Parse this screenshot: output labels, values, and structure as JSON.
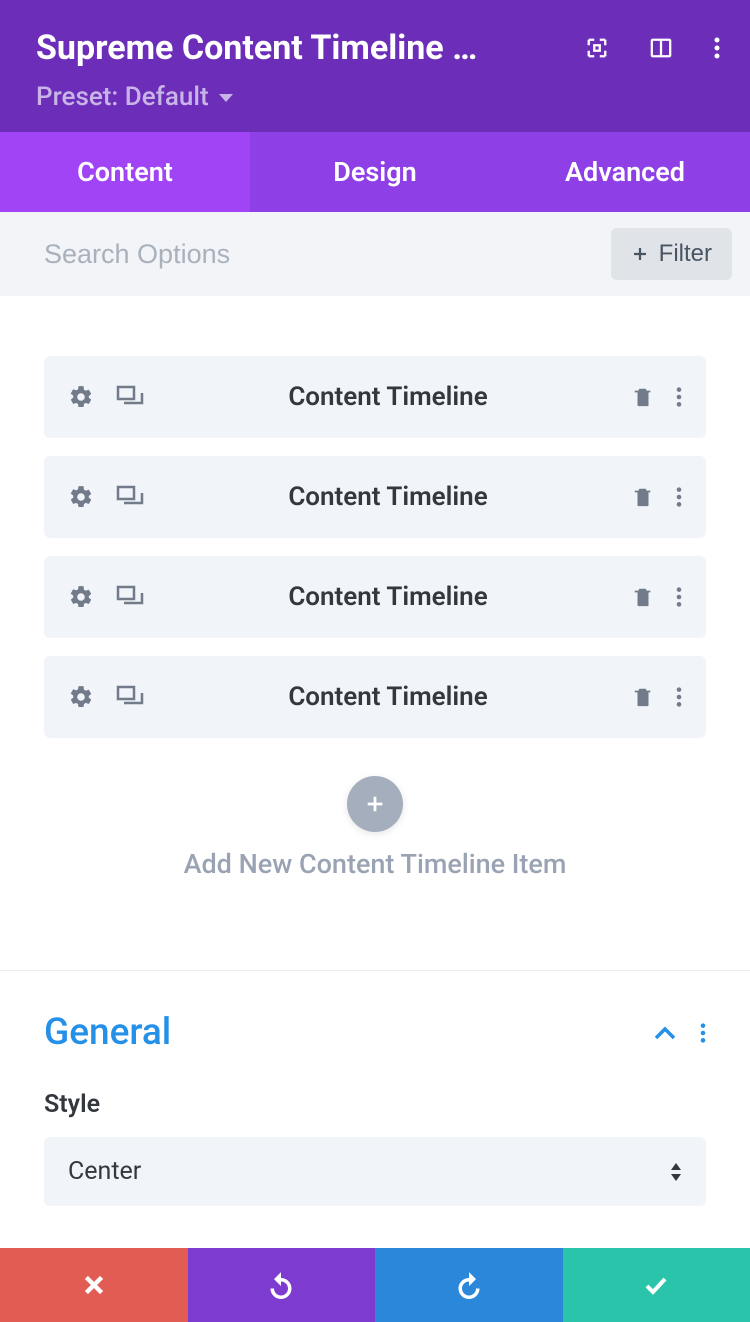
{
  "header": {
    "title": "Supreme Content Timeline …",
    "preset_prefix": "Preset:",
    "preset_name": "Default"
  },
  "tabs": {
    "content": "Content",
    "design": "Design",
    "advanced": "Advanced"
  },
  "search": {
    "placeholder": "Search Options"
  },
  "filter": {
    "label": "Filter"
  },
  "timeline_items": [
    {
      "label": "Content Timeline"
    },
    {
      "label": "Content Timeline"
    },
    {
      "label": "Content Timeline"
    },
    {
      "label": "Content Timeline"
    }
  ],
  "add_new": {
    "label": "Add New Content Timeline Item"
  },
  "general": {
    "title": "General",
    "style_label": "Style",
    "style_value": "Center"
  }
}
